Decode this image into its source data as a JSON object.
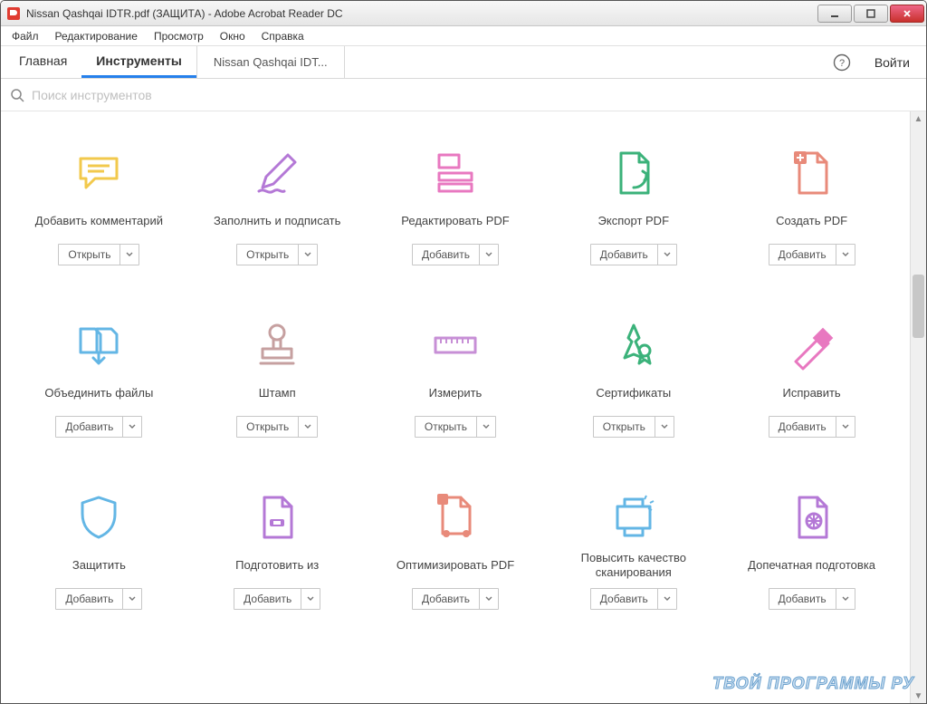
{
  "window": {
    "title": "Nissan Qashqai IDTR.pdf (ЗАЩИТА) - Adobe Acrobat Reader DC"
  },
  "menu": {
    "items": [
      "Файл",
      "Редактирование",
      "Просмотр",
      "Окно",
      "Справка"
    ]
  },
  "nav": {
    "tabs": [
      {
        "label": "Главная",
        "active": false
      },
      {
        "label": "Инструменты",
        "active": true
      }
    ],
    "document_tab": "Nissan Qashqai IDT...",
    "signin": "Войти"
  },
  "search": {
    "placeholder": "Поиск инструментов"
  },
  "actions": {
    "open": "Открыть",
    "add": "Добавить"
  },
  "tools": [
    {
      "id": "comment",
      "label": "Добавить комментарий",
      "button": "open",
      "icon": "comment-icon",
      "color": "#f2c94c"
    },
    {
      "id": "fill-sign",
      "label": "Заполнить и подписать",
      "button": "open",
      "icon": "pencil-sign-icon",
      "color": "#b478d6"
    },
    {
      "id": "edit-pdf",
      "label": "Редактировать PDF",
      "button": "add",
      "icon": "edit-pdf-icon",
      "color": "#e878c0"
    },
    {
      "id": "export-pdf",
      "label": "Экспорт PDF",
      "button": "add",
      "icon": "export-pdf-icon",
      "color": "#3bb27a"
    },
    {
      "id": "create-pdf",
      "label": "Создать PDF",
      "button": "add",
      "icon": "create-pdf-icon",
      "color": "#e88a7a"
    },
    {
      "id": "combine",
      "label": "Объединить файлы",
      "button": "add",
      "icon": "combine-icon",
      "color": "#63b6e5"
    },
    {
      "id": "stamp",
      "label": "Штамп",
      "button": "open",
      "icon": "stamp-icon",
      "color": "#c6a0a0"
    },
    {
      "id": "measure",
      "label": "Измерить",
      "button": "open",
      "icon": "ruler-icon",
      "color": "#c78fd6"
    },
    {
      "id": "certificates",
      "label": "Сертификаты",
      "button": "open",
      "icon": "certificate-icon",
      "color": "#3bb27a"
    },
    {
      "id": "redact",
      "label": "Исправить",
      "button": "add",
      "icon": "redact-icon",
      "color": "#e878c0"
    },
    {
      "id": "protect",
      "label": "Защитить",
      "button": "add",
      "icon": "shield-icon",
      "color": "#63b6e5"
    },
    {
      "id": "prepare",
      "label": "Подготовить из",
      "button": "add",
      "icon": "prepare-form-icon",
      "color": "#b478d6"
    },
    {
      "id": "optimize",
      "label": "Оптимизировать PDF",
      "button": "add",
      "icon": "optimize-icon",
      "color": "#e88a7a"
    },
    {
      "id": "enhance-scan",
      "label": "Повысить качество сканирования",
      "button": "add",
      "icon": "enhance-scan-icon",
      "color": "#63b6e5"
    },
    {
      "id": "preflight",
      "label": "Допечатная подготовка",
      "button": "add",
      "icon": "preflight-icon",
      "color": "#b478d6"
    }
  ],
  "watermark": "ТВОЙ ПРОГРАММЫ РУ"
}
